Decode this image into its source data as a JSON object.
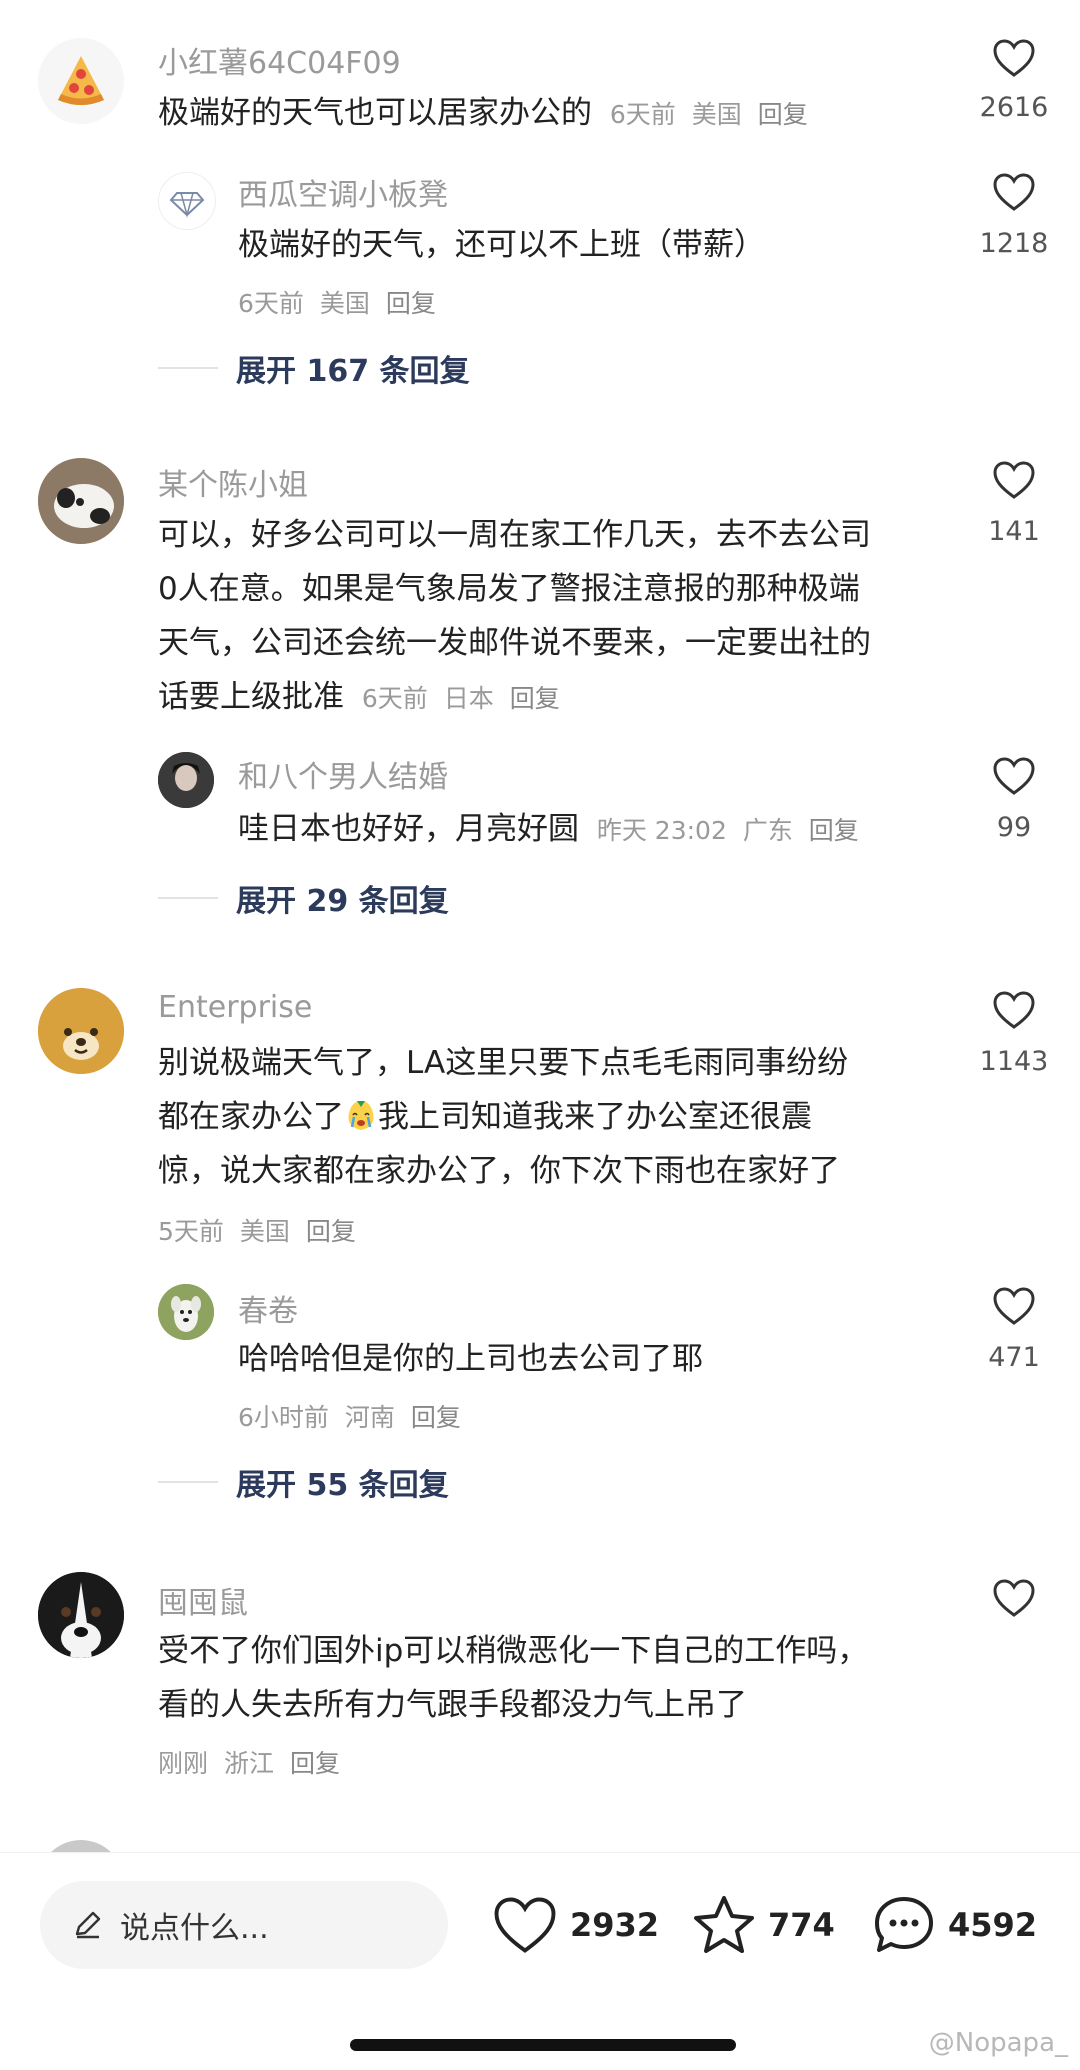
{
  "comments": [
    {
      "user": "小红薯64C04F09",
      "text": "极端好的天气也可以居家办公的",
      "time": "6天前",
      "location": "美国",
      "reply": "回复",
      "likes": "2616",
      "sub": {
        "user": "西瓜空调小板凳",
        "text": "极端好的天气，还可以不上班（带薪）",
        "time": "6天前",
        "location": "美国",
        "reply": "回复",
        "likes": "1218"
      },
      "expand": "展开 167 条回复"
    },
    {
      "user": "某个陈小姐",
      "lines": [
        "可以，好多公司可以一周在家工作几天，去不去公司",
        "0人在意。如果是气象局发了警报注意报的那种极端",
        "天气，公司还会统一发邮件说不要来，一定要出社的",
        "话要上级批准"
      ],
      "time": "6天前",
      "location": "日本",
      "reply": "回复",
      "likes": "141",
      "sub": {
        "user": "和八个男人结婚",
        "text": "哇日本也好好，月亮好圆",
        "time": "昨天 23:02",
        "location": "广东",
        "reply": "回复",
        "likes": "99"
      },
      "expand": "展开 29 条回复"
    },
    {
      "user": "Enterprise",
      "line1": "别说极端天气了，LA这里只要下点毛毛雨同事纷纷",
      "line2a": "都在家办公了",
      "line2b": "我上司知道我来了办公室还很震",
      "line3": "惊，说大家都在家办公了，你下次下雨也在家好了",
      "time": "5天前",
      "location": "美国",
      "reply": "回复",
      "likes": "1143",
      "sub": {
        "user": "春卷",
        "text": "哈哈哈但是你的上司也去公司了耶",
        "time": "6小时前",
        "location": "河南",
        "reply": "回复",
        "likes": "471"
      },
      "expand": "展开 55 条回复"
    },
    {
      "user": "囤囤鼠",
      "lines": [
        "受不了你们国外ip可以稍微恶化一下自己的工作吗，",
        "看的人失去所有力气跟手段都没力气上吊了"
      ],
      "time": "刚刚",
      "location": "浙江",
      "reply": "回复"
    }
  ],
  "bottom": {
    "placeholder": "说点什么...",
    "likes": "2932",
    "stars": "774",
    "comments": "4592"
  },
  "watermark": "@Nopapa_",
  "colors": {
    "accent_text": "#2c3a5c",
    "muted": "#9a9a9a"
  }
}
